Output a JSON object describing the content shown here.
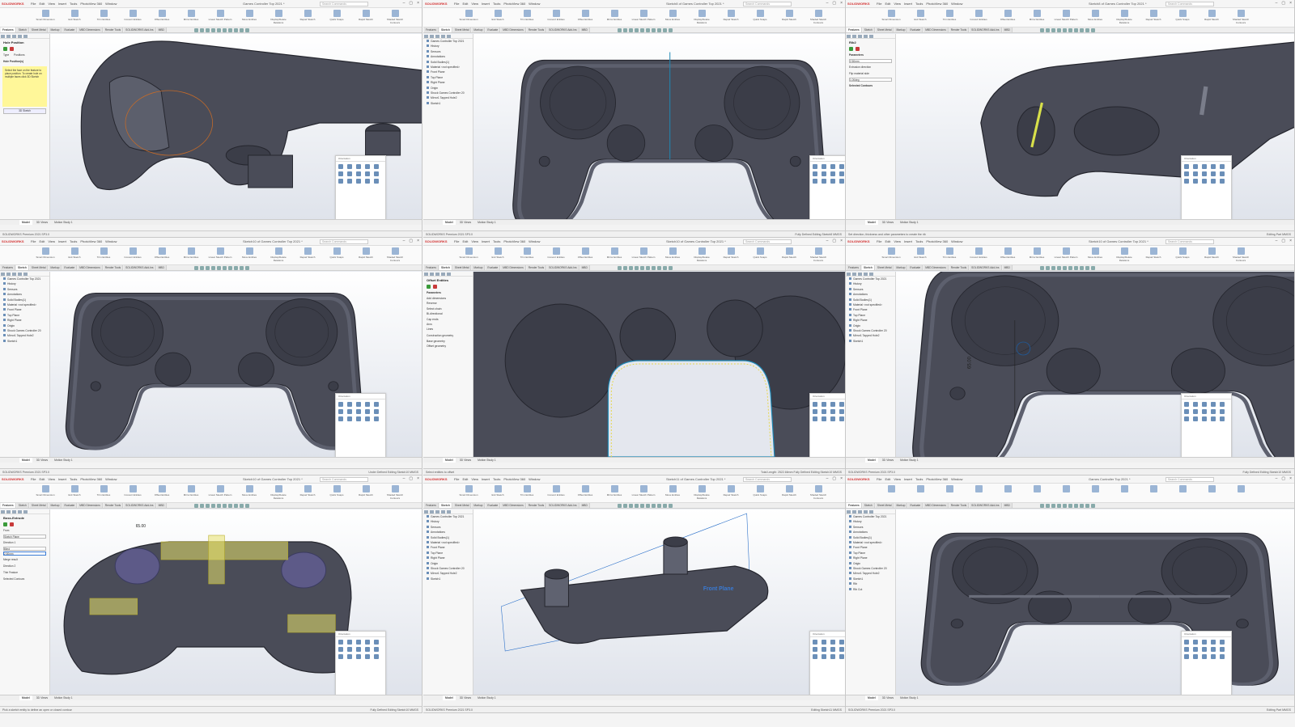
{
  "app": {
    "name": "SOLIDWORKS"
  },
  "menus": [
    "File",
    "Edit",
    "View",
    "Insert",
    "Tools",
    "PhotoView 360",
    "Window"
  ],
  "search_placeholder": "Search Commands",
  "command_tabs": [
    "Features",
    "Sketch",
    "Sheet Metal",
    "Markup",
    "Evaluate",
    "MBD Dimensions",
    "Render Tools",
    "SOLIDWORKS Add-Ins",
    "MBD"
  ],
  "sketch_ribbon": [
    "Smart Dimension",
    "Exit Sketch",
    "Trim Entities",
    "Convert Entities",
    "Offset Entities",
    "Mirror Entities",
    "Linear Sketch Pattern",
    "Move Entities",
    "Display/Delete Relations",
    "Repair Sketch",
    "Quick Snaps",
    "Rapid Sketch",
    "Shaded Sketch Contours"
  ],
  "bottom_tabs": [
    "Model",
    "3D Views",
    "Motion Study 1"
  ],
  "tree": [
    "Games Controller Top 2021",
    "History",
    "Sensors",
    "Annotations",
    "Solid Bodies(1)",
    "Material <not specified>",
    "Front Plane",
    "Top Plane",
    "Right Plane",
    "Origin",
    "Shock Games Controller 20",
    "Mirror1 Tapped Hole2",
    "Sketch1"
  ],
  "task_pane_title": "Orientation",
  "panels": [
    {
      "title": "Games Controller Top 2021 *",
      "breadcrumb": "Games Controller To...",
      "pm_title": "Hole Position",
      "pm_tabs": [
        "Type",
        "Positions"
      ],
      "pm_section": "Hole Position(s)",
      "pm_message": "Select the face on the feature to place position. To create hole on multiple faces click 3D Sketch",
      "pm_button": "3D Sketch",
      "status_left": "SOLIDWORKS Premium 2021 SP3.0",
      "status_right": ""
    },
    {
      "title": "Sketch8 of Games Controller Top 2021 *",
      "breadcrumb": "Games Controller To...",
      "status_left": "SOLIDWORKS Premium 2021 SP3.0",
      "status_right": "Fully Defined   Editing Sketch8   MMGS"
    },
    {
      "title": "Sketch8 of Games Controller Top 2021 *",
      "breadcrumb": "Games Controller To...",
      "pm_title": "Rib2",
      "pm_section": "Parameters",
      "pm_field": "2.50mm",
      "pm_field2": "1.00deg",
      "pm_label2": "Extrusion direction",
      "pm_label3": "Flip material side",
      "pm_label4": "Selected Contours",
      "status_left": "Set direction, thickness and other parameters to create the rib",
      "status_right": "Editing Part   MMGS"
    },
    {
      "title": "Sketch10 of Games Controller Top 2021 *",
      "breadcrumb": "",
      "status_left": "SOLIDWORKS Premium 2021 SP3.0",
      "status_right": "Under Defined   Editing Sketch10   MMGS"
    },
    {
      "title": "Sketch10 of Games Controller Top 2021 *",
      "breadcrumb": "",
      "pm_title": "Offset Entities",
      "pm_section": "Parameters",
      "pm_options": [
        "Add dimensions",
        "Reverse",
        "Select chain",
        "Bi-directional",
        "Cap ends",
        "Arcs",
        "Lines"
      ],
      "pm_section2": "Construction geometry",
      "pm_options2": [
        "Base geometry",
        "Offset geometry"
      ],
      "status_left": "Select entities to offset",
      "status_right": "Total Length: 2522.66mm   Fully Defined   Editing Sketch10   MMGS"
    },
    {
      "title": "Sketch10 of Games Controller Top 2021 *",
      "breadcrumb": "",
      "dimension": "65.00",
      "status_left": "SOLIDWORKS Premium 2021 SP3.0",
      "status_right": "Fully Defined   Editing Sketch10   MMGS"
    },
    {
      "title": "Sketch10 of Games Controller Top 2021 *",
      "breadcrumb": "Games Controller To...",
      "pm_title": "Boss-Extrude",
      "pm_section": "From",
      "pm_from": "Sketch Plane",
      "pm_dir": "Direction 1",
      "pm_blind": "Blind",
      "pm_depth": "2.50mm",
      "pm_merge": "Merge result",
      "pm_dir2": "Direction 2",
      "pm_thin": "Thin Feature",
      "pm_contours": "Selected Contours",
      "dim_label": "65.00",
      "status_left": "Pick a sketch entity to define an open or closed contour",
      "status_right": "Fully Defined   Editing Sketch10   MMGS"
    },
    {
      "title": "Sketch11 of Games Controller Top 2021 *",
      "breadcrumb": "",
      "plane_label": "Front Plane",
      "status_left": "SOLIDWORKS Premium 2021 SP3.0",
      "status_right": "Editing Sketch11   MMGS"
    },
    {
      "title": "Games Controller Top 2021 *",
      "breadcrumb": "",
      "tree_extra": [
        "Rib",
        "Rib Cut"
      ],
      "status_left": "SOLIDWORKS Premium 2021 SP3.0",
      "status_right": "Editing Part   MMGS"
    }
  ]
}
